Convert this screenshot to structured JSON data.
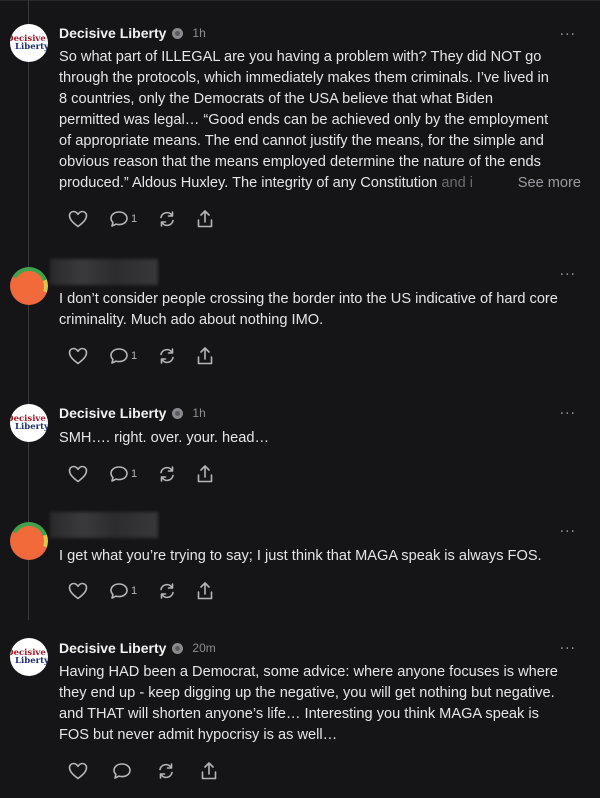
{
  "comments": [
    {
      "author": "Decisive Liberty",
      "time": "1h",
      "avatar": {
        "line1": "Decisive",
        "line2": "Liberty"
      },
      "text_lines": [
        "So what part of ILLEGAL are you having a problem with? They did NOT go",
        "through the protocols, which immediately makes them criminals. I’ve lived in",
        "8 countries, only the Democrats of the USA believe that what Biden",
        "permitted was legal… “Good ends can be achieved only by the employment",
        "of appropriate means. The end cannot justify the means, for the simple and",
        "obvious reason that the means employed determine the nature of the ends",
        "produced.” Aldous Huxley. The integrity of any Constitution and i"
      ],
      "text_fade": "and i",
      "see_more": "See more",
      "comment_count": "1"
    },
    {
      "author": "",
      "time": "",
      "text_lines": [
        "I don’t consider people crossing the border into the US indicative of hard core",
        "criminality. Much ado about nothing IMO."
      ],
      "comment_count": "1"
    },
    {
      "author": "Decisive Liberty",
      "time": "1h",
      "avatar": {
        "line1": "Decisive",
        "line2": "Liberty"
      },
      "text_lines": [
        "SMH…. right. over. your. head…"
      ],
      "comment_count": "1"
    },
    {
      "author": "",
      "time": "",
      "text_lines": [
        "I get what you’re trying to say; I just think that MAGA speak is always FOS."
      ],
      "comment_count": "1"
    },
    {
      "author": "Decisive Liberty",
      "time": "20m",
      "avatar": {
        "line1": "Decisive",
        "line2": "Liberty"
      },
      "text_lines": [
        "Having HAD been a Democrat, some advice: where anyone focuses is where",
        "they end up - keep digging up the negative, you will get nothing but negative.",
        "and THAT will shorten anyone’s life… Interesting you think MAGA speak is",
        "FOS but never admit hypocrisy is as well…"
      ],
      "comment_count": ""
    }
  ],
  "more_glyph": "···",
  "icons": {
    "like": "heart-icon",
    "comment": "comment-icon",
    "restack": "restack-icon",
    "share": "share-icon"
  }
}
